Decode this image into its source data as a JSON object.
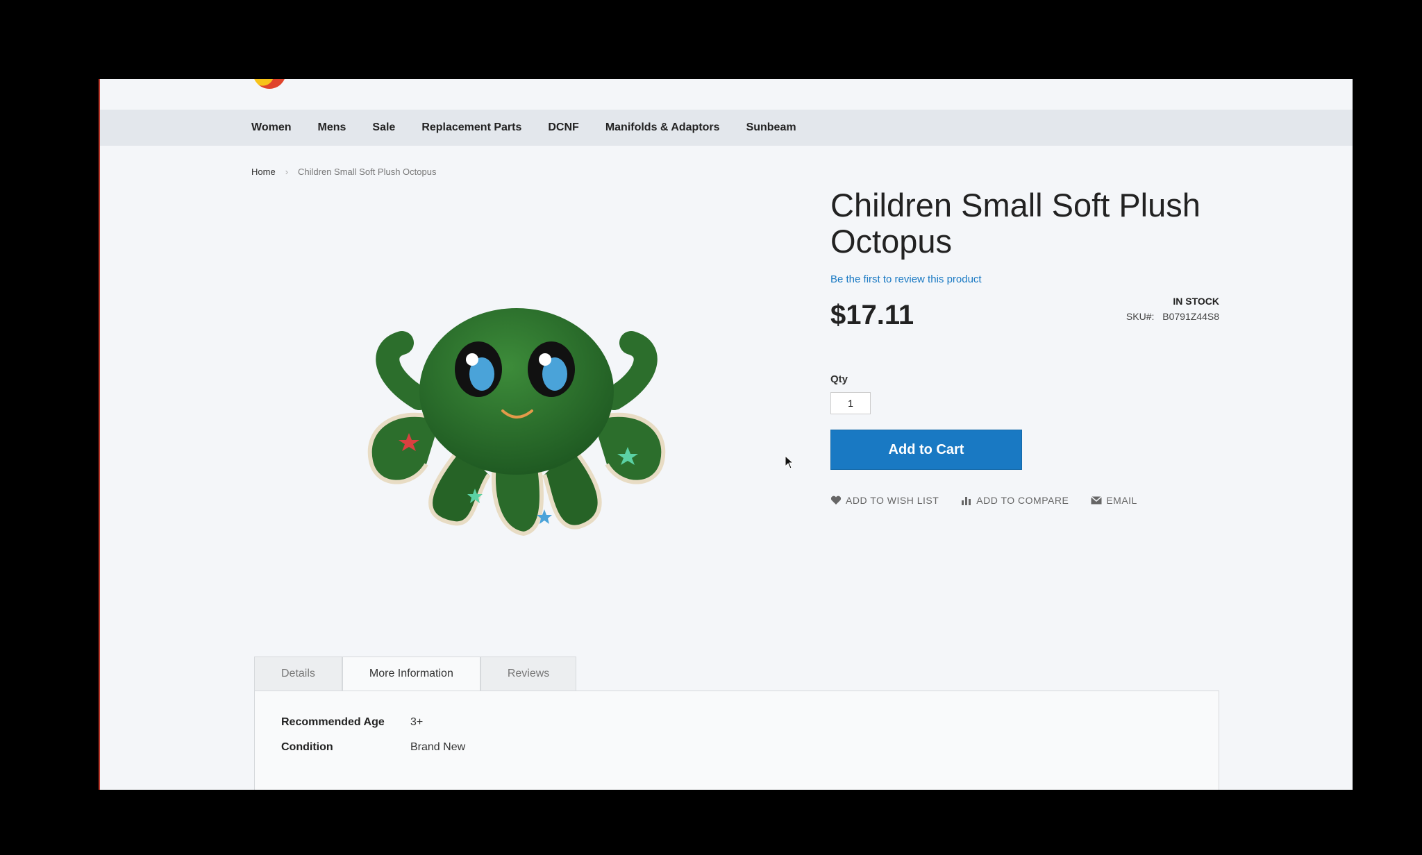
{
  "nav": {
    "items": [
      "Women",
      "Mens",
      "Sale",
      "Replacement Parts",
      "DCNF",
      "Manifolds & Adaptors",
      "Sunbeam"
    ]
  },
  "breadcrumb": {
    "home": "Home",
    "separator": "›",
    "current": "Children Small Soft Plush Octopus"
  },
  "product": {
    "title": "Children Small Soft Plush Octopus",
    "review_link": "Be the first to review this product",
    "price": "$17.11",
    "stock_status": "IN STOCK",
    "sku_label": "SKU#:",
    "sku_value": "B0791Z44S8",
    "qty_label": "Qty",
    "qty_value": "1",
    "add_to_cart": "Add to Cart",
    "image_icon": "green-plush-octopus"
  },
  "actions": {
    "wishlist": "ADD TO WISH LIST",
    "compare": "ADD TO COMPARE",
    "email": "EMAIL"
  },
  "tabs": {
    "details": "Details",
    "more_info": "More Information",
    "reviews": "Reviews",
    "active": "More Information"
  },
  "specs": {
    "rows": [
      {
        "label": "Recommended Age",
        "value": "3+"
      },
      {
        "label": "Condition",
        "value": "Brand New"
      }
    ]
  },
  "colors": {
    "accent": "#1979c3",
    "octopus": "#2e7d32"
  }
}
